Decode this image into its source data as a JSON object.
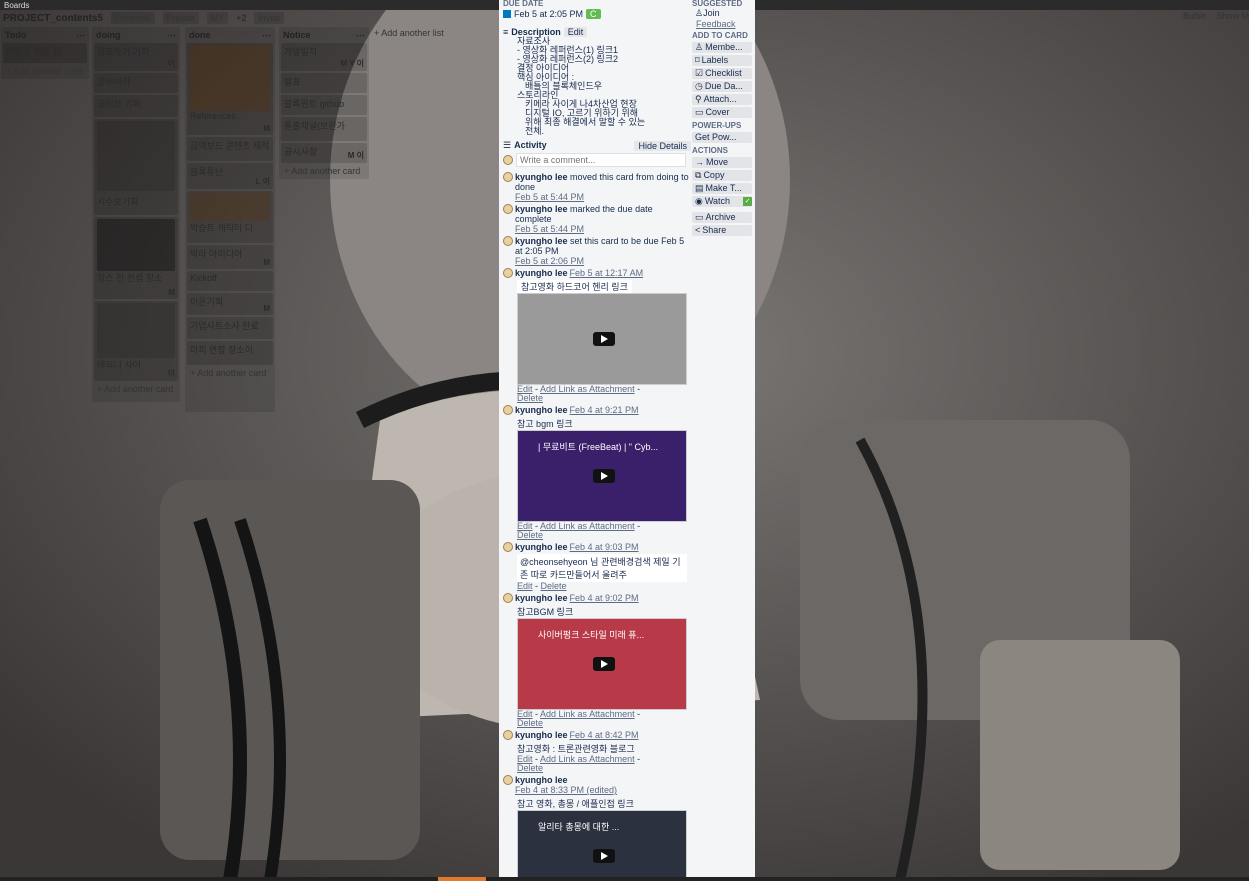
{
  "app": {
    "boards_label": "Boards"
  },
  "board": {
    "title": "PROJECT_contents5",
    "personal": "Personal",
    "visibility": "Private",
    "team": "MY",
    "member_count": "+2",
    "invite": "Invite",
    "butler": "Butler",
    "show_menu": "Show M",
    "add_list": "Add another list"
  },
  "lists": [
    {
      "title": "Todo",
      "cards": [
        "리뷰스 연장 선"
      ],
      "add": "Add another card"
    },
    {
      "title": "doing",
      "cards": [
        "발표하기 기회",
        "웅버셔리",
        "공리브 기획",
        "시수보기회",
        "장스 판 컨셉 장소",
        "테되니 사이"
      ],
      "add": "Add another card"
    },
    {
      "title": "done",
      "cards": [
        "References",
        "금액보드 콘텐츠 제작",
        "블록튜난",
        "박승트 캐릭터 디",
        "박라 아이디어",
        "Kickoff",
        "이온기획",
        "기업사트소사 완료",
        "마피 연합 장소이"
      ],
      "add": "Add another card"
    },
    {
      "title": "Notice",
      "cards": [
        "개발일지",
        "발표",
        "블록원트 github",
        "돌출채널(보완가",
        "공시사항"
      ],
      "add": "Add another card"
    }
  ],
  "card_modal": {
    "due_heading": "DUE DATE",
    "due_value": "Feb 5 at 2:05 PM",
    "description_label": "Description",
    "edit": "Edit",
    "desc_lines": [
      "자료조사",
      "- 영상화 레퍼런스(1) 링크1",
      "- 영상화 레퍼런스(2) 링크2",
      "결정 아이디어",
      "핵심 아이디어 :",
      "배틀의 블록체인드우",
      "스토리라인",
      "키메라 사이게 나4차산업 현장",
      "디지털 IO, 고르기 위하기 위해",
      "위해 최종 해결에서 말할 수 있는",
      "전체."
    ],
    "activity_label": "Activity",
    "hide_details": "Hide Details",
    "comment_placeholder": "Write a comment...",
    "entries": [
      {
        "who": "kyungho lee",
        "text": "moved this card from doing to done",
        "time": "Feb 5 at 5:44 PM"
      },
      {
        "who": "kyungho lee",
        "text": "marked the due date complete",
        "time": "Feb 5 at 5:44 PM"
      },
      {
        "who": "kyungho lee",
        "text": "set this card to be due Feb 5 at 2:05 PM",
        "time": "Feb 5 at 2:06 PM"
      },
      {
        "who": "kyungho lee",
        "time": "Feb 5 at 12:17 AM",
        "comment": "참고영화 하드코어 헨리 링크",
        "embed": "",
        "embed_bg": "#9a9a9a"
      },
      {
        "who": "kyungho lee",
        "time": "Feb 4 at 9:21 PM",
        "comment": "참고 bgm 링크",
        "embed": "| 무료비트 (FreeBeat) | \" Cyb...",
        "embed_bg": "#3a1f6a"
      },
      {
        "who": "kyungho lee",
        "time": "Feb 4 at 9:03 PM",
        "comment": "@cheonsehyeon 님 관련배경검색 제일 기존 따로 카드만들어서 올려주"
      },
      {
        "who": "kyungho lee",
        "time": "Feb 4 at 9:02 PM",
        "comment": "참고BGM 링크",
        "embed": "사이버펑크 스타일 미래 퓨...",
        "embed_bg": "#b83a48"
      },
      {
        "who": "kyungho lee",
        "time": "Feb 4 at 8:42 PM",
        "comment": "참고영화 : 트론관련영화 블로그"
      },
      {
        "who": "kyungho lee",
        "time": "Feb 4 at 8:33 PM (edited)",
        "comment": "참고 영화, 총몽 / 애플인접 링크",
        "embed": "알리타 총몽에 대한 ...",
        "embed_bg": "#2c3140"
      }
    ],
    "embed_foot": {
      "edit": "Edit",
      "add_link": "Add Link as Attachment",
      "delete": "Delete"
    }
  },
  "sidebar": {
    "suggested": "SUGGESTED",
    "join": "Join",
    "feedback": "Feedback",
    "add_to_card": "ADD TO CARD",
    "add_buttons": [
      "Membe...",
      "Labels",
      "Checklist",
      "Due Da...",
      "Attach...",
      "Cover"
    ],
    "powerups": "POWER-UPS",
    "get_powerups": "Get Pow...",
    "actions": "ACTIONS",
    "action_buttons": [
      "Move",
      "Copy",
      "Make T...",
      "Watch",
      "Archive",
      "Share"
    ]
  },
  "colors": {
    "due_badge": "#61bd4f",
    "watch_check": "#5aac44",
    "modal_bg": "#f4f5f7"
  }
}
